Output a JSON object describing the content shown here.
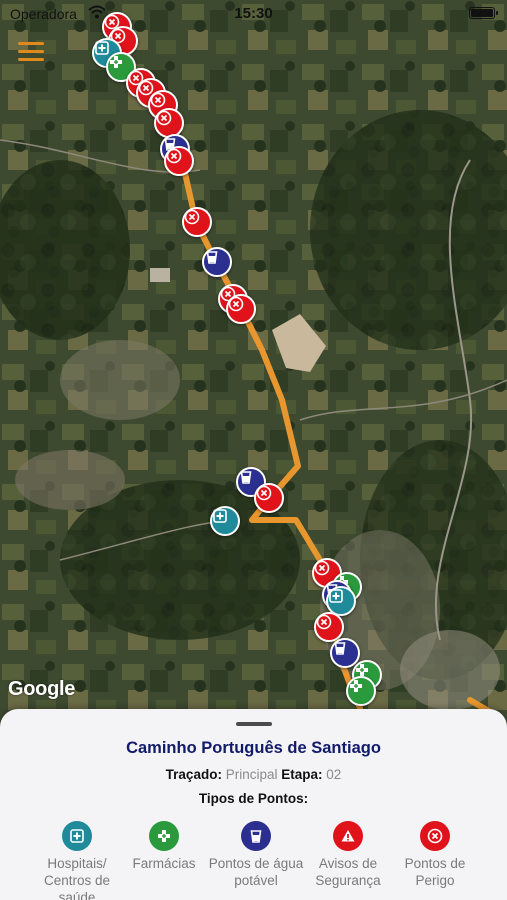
{
  "status_bar": {
    "carrier": "Operadora",
    "time": "15:30"
  },
  "map": {
    "provider_logo": "Google",
    "icons": {
      "menu": "hamburger-menu-icon",
      "hospital": "medical-cross-icon",
      "pharmacy": "pharmacy-cross-icon",
      "water": "water-cup-icon",
      "warning": "warning-triangle-icon",
      "danger": "danger-x-icon"
    },
    "colors": {
      "route": "#e8962e",
      "danger": "#e0131b",
      "water": "#2b2f8f",
      "hospital": "#1f8a9a",
      "pharmacy": "#2a9a3c"
    }
  },
  "sheet": {
    "title": "Caminho Português de Santiago",
    "route_label": "Traçado:",
    "route_value": "Principal",
    "stage_label": "Etapa:",
    "stage_value": "02",
    "types_title": "Tipos de Pontos:",
    "legend": [
      {
        "label": "Hospitais/ Centros de saúde",
        "icon": "medical-cross-icon",
        "color": "#1f8a9a"
      },
      {
        "label": "Farmácias",
        "icon": "pharmacy-cross-icon",
        "color": "#2a9a3c"
      },
      {
        "label": "Pontos de água potável",
        "icon": "water-cup-icon",
        "color": "#2b2f8f"
      },
      {
        "label": "Avisos de Segurança",
        "icon": "warning-triangle-icon",
        "color": "#e0131b"
      },
      {
        "label": "Pontos de Perigo",
        "icon": "danger-x-icon",
        "color": "#e0131b"
      }
    ]
  }
}
